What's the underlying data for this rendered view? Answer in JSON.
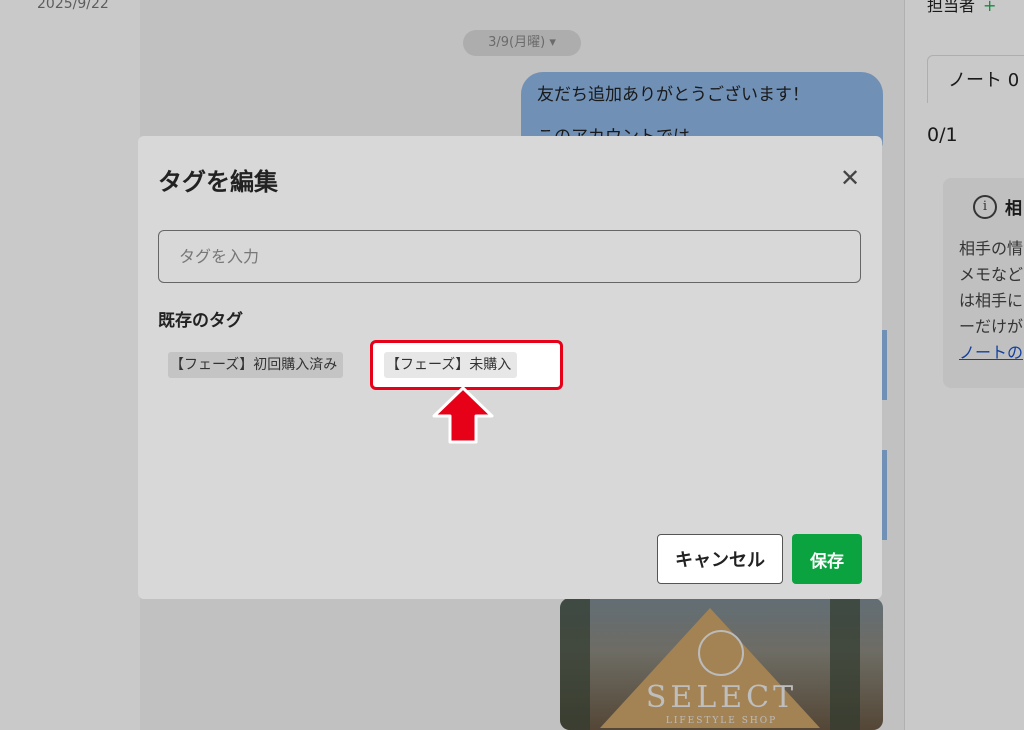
{
  "background": {
    "left_date": "2025/9/22",
    "chat_date_pill": "3/9(月曜) ▾",
    "bubble_line1": "友だち追加ありがとうございます！",
    "bubble_line2": "このアカウントでは",
    "brand_name": "SELECT",
    "brand_sub": "LIFESTYLE SHOP",
    "right_panel": {
      "top_label": "担当者",
      "top_value": "+",
      "note_tab": "ノート 0",
      "count": "0/1",
      "info_title": "相",
      "info_lines": [
        "相手の情",
        "メモなど",
        "は相手に",
        "ーだけが"
      ],
      "info_link": "ノートの"
    }
  },
  "modal": {
    "title": "タグを編集",
    "close_icon": "close-icon",
    "input_placeholder": "タグを入力",
    "input_value": "",
    "existing_label": "既存のタグ",
    "tags": [
      "【フェーズ】初回購入済み",
      "【フェーズ】未購入"
    ],
    "cancel_label": "キャンセル",
    "save_label": "保存"
  },
  "annotation": {
    "highlight_color": "#e60018",
    "arrow_icon": "up-arrow-icon"
  },
  "colors": {
    "save_button": "#0ba33f",
    "bubble": "#8fb7e6"
  }
}
